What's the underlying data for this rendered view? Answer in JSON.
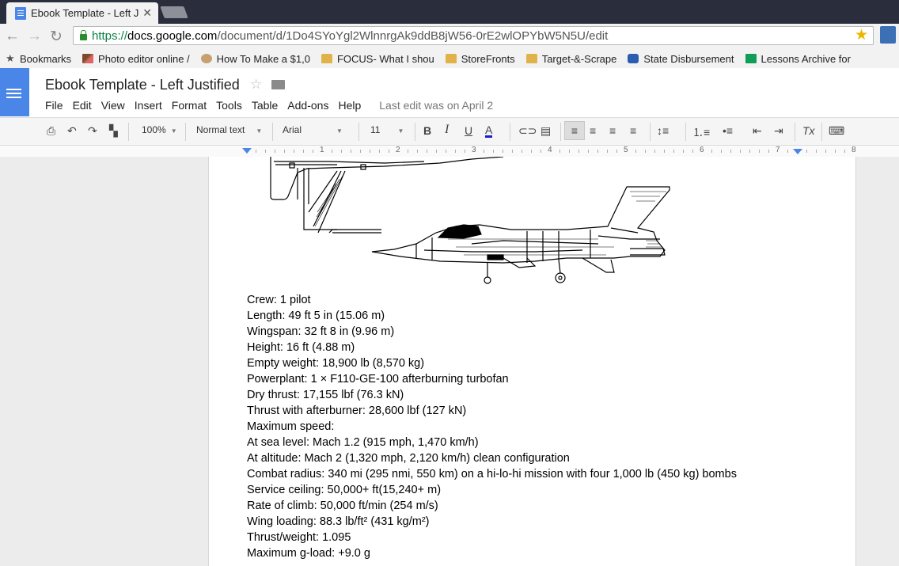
{
  "browser": {
    "tab_title": "Ebook Template - Left Ju",
    "url_scheme": "https://",
    "url_host": "docs.google.com",
    "url_path": "/document/d/1Do4SYoYgl2WlnnrgAk9ddB8jW56-0rE2wlOPYbW5N5U/edit",
    "bookmarks": [
      {
        "label": "Bookmarks",
        "icon": "star-icon"
      },
      {
        "label": "Photo editor online /",
        "icon": "brush-icon"
      },
      {
        "label": "How To Make a $1,0",
        "icon": "avatar-icon"
      },
      {
        "label": "FOCUS- What I shou",
        "icon": "folder-icon"
      },
      {
        "label": "StoreFronts",
        "icon": "folder-icon"
      },
      {
        "label": "Target-&-Scrape",
        "icon": "folder-icon"
      },
      {
        "label": "State Disbursement",
        "icon": "seal-icon"
      },
      {
        "label": "Lessons Archive for",
        "icon": "sheet-icon"
      }
    ]
  },
  "docs": {
    "title": "Ebook Template - Left Justified",
    "menu": [
      "File",
      "Edit",
      "View",
      "Insert",
      "Format",
      "Tools",
      "Table",
      "Add-ons",
      "Help"
    ],
    "last_edit": "Last edit was on April 2",
    "toolbar": {
      "zoom": "100%",
      "style": "Normal text",
      "font": "Arial",
      "size": "11",
      "bold": "B",
      "italic": "I",
      "underline": "U",
      "text_color": "A",
      "clear_format": "Tx"
    },
    "ruler_numbers": [
      "1",
      "2",
      "3",
      "4",
      "5",
      "6",
      "7",
      "8"
    ]
  },
  "document": {
    "lines": [
      "Crew: 1 pilot",
      "Length: 49 ft 5 in (15.06 m)",
      "Wingspan: 32 ft 8 in (9.96 m)",
      "Height: 16 ft (4.88 m)",
      "Empty weight: 18,900 lb (8,570 kg)",
      "Powerplant: 1 × F110-GE-100 afterburning turbofan",
      "Dry thrust: 17,155 lbf (76.3 kN)",
      "Thrust with afterburner: 28,600 lbf (127 kN)",
      "Maximum speed:",
      "At sea level: Mach 1.2 (915 mph, 1,470 km/h)",
      "At altitude: Mach 2 (1,320 mph, 2,120 km/h) clean configuration",
      "Combat radius: 340 mi (295 nmi, 550 km) on a hi-lo-hi mission with four 1,000 lb (450 kg) bombs",
      "Service ceiling: 50,000+ ft(15,240+ m)",
      "Rate of climb: 50,000 ft/min (254 m/s)",
      "Wing loading: 88.3 lb/ft² (431 kg/m²)",
      "Thrust/weight: 1.095",
      "Maximum g-load: +9.0 g"
    ]
  },
  "colors": {
    "docs_blue": "#4a86e8",
    "tab_strip": "#2a2d3b",
    "url_green": "#0b8043"
  }
}
